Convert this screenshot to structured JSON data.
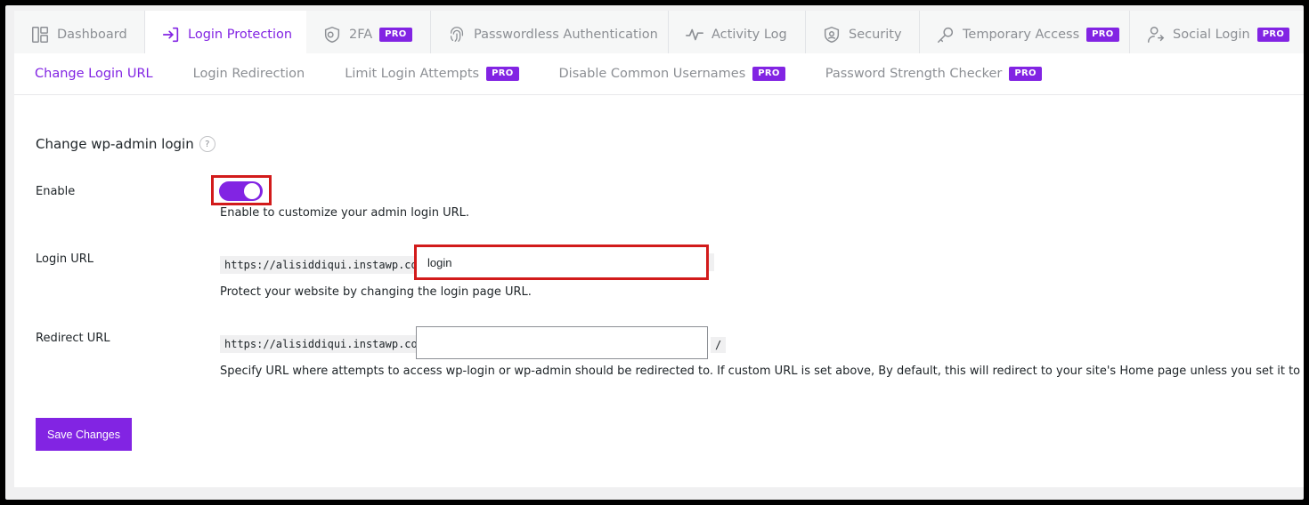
{
  "top_tabs": [
    {
      "label": "Dashboard",
      "icon": "dashboard-icon",
      "pro": false,
      "active": false
    },
    {
      "label": "Login Protection",
      "icon": "login-icon",
      "pro": false,
      "active": true
    },
    {
      "label": "2FA",
      "icon": "shield-2fa-icon",
      "pro": true,
      "active": false
    },
    {
      "label": "Passwordless Authentication",
      "icon": "fingerprint-icon",
      "pro": false,
      "active": false
    },
    {
      "label": "Activity Log",
      "icon": "activity-icon",
      "pro": false,
      "active": false
    },
    {
      "label": "Security",
      "icon": "security-shield-icon",
      "pro": false,
      "active": false
    },
    {
      "label": "Temporary Access",
      "icon": "key-icon",
      "pro": true,
      "active": false
    },
    {
      "label": "Social Login",
      "icon": "user-icon",
      "pro": true,
      "active": false
    }
  ],
  "pro_label": "PRO",
  "sub_tabs": [
    {
      "label": "Change Login URL",
      "pro": false,
      "active": true
    },
    {
      "label": "Login Redirection",
      "pro": false,
      "active": false
    },
    {
      "label": "Limit Login Attempts",
      "pro": true,
      "active": false
    },
    {
      "label": "Disable Common Usernames",
      "pro": true,
      "active": false
    },
    {
      "label": "Password Strength Checker",
      "pro": true,
      "active": false
    }
  ],
  "section": {
    "title": "Change wp-admin login",
    "help": "?"
  },
  "enable": {
    "label": "Enable",
    "on": true,
    "description": "Enable to customize your admin login URL."
  },
  "login_url": {
    "label": "Login URL",
    "prefix": "https://alisiddiqui.instawp.co/",
    "value": "login",
    "description": "Protect your website by changing the login page URL."
  },
  "redirect_url": {
    "label": "Redirect URL",
    "prefix": "https://alisiddiqui.instawp.co/",
    "value": "",
    "suffix": "/",
    "description": "Specify URL where attempts to access wp-login or wp-admin should be redirected to. If custom URL is set above, By default, this will redirect to your site's Home page unless you set it to something else."
  },
  "save_label": "Save Changes",
  "colors": {
    "accent": "#8224e3",
    "highlight_border": "#d21b1b"
  }
}
